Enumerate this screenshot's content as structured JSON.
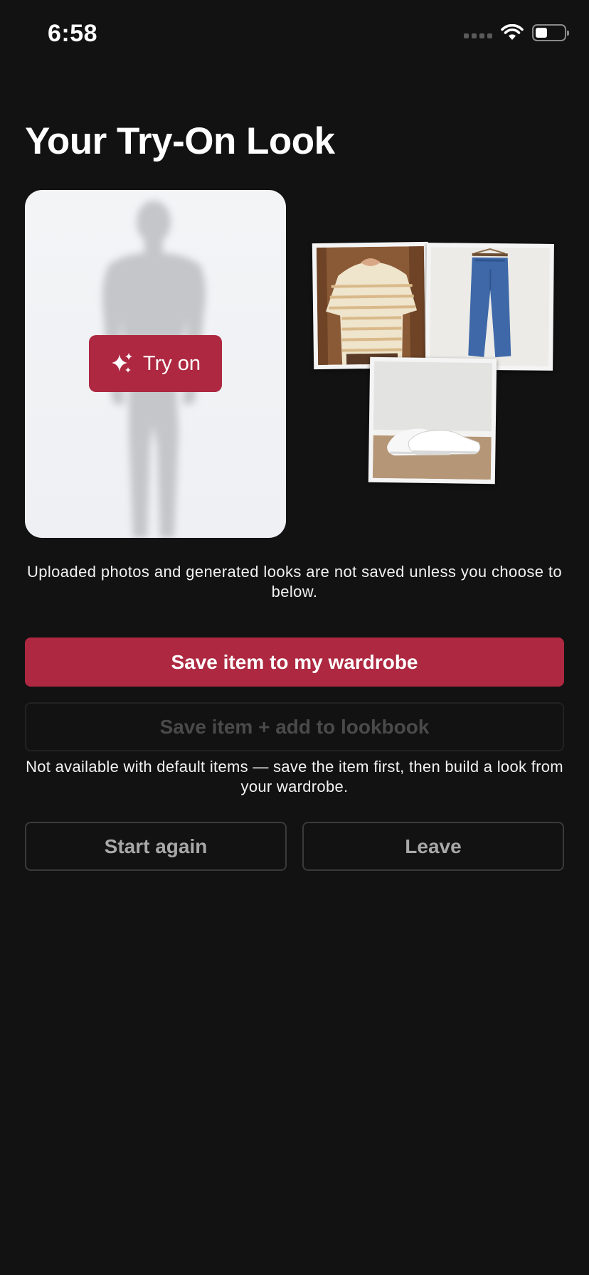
{
  "status_bar": {
    "time": "6:58"
  },
  "page": {
    "title": "Your Try-On Look"
  },
  "avatar_card": {
    "try_on_label": "Try on"
  },
  "collage": {
    "items": [
      "t-shirt",
      "jeans",
      "sneakers"
    ]
  },
  "disclaimer": "Uploaded photos and generated looks are not saved unless you choose to below.",
  "actions": {
    "save_wardrobe": "Save item to my wardrobe",
    "save_lookbook": "Save item + add to lookbook",
    "lookbook_note": "Not available with default items — save the item first, then build a look from your wardrobe.",
    "start_again": "Start again",
    "leave": "Leave"
  },
  "colors": {
    "accent": "#ad2840",
    "background": "#121212"
  }
}
